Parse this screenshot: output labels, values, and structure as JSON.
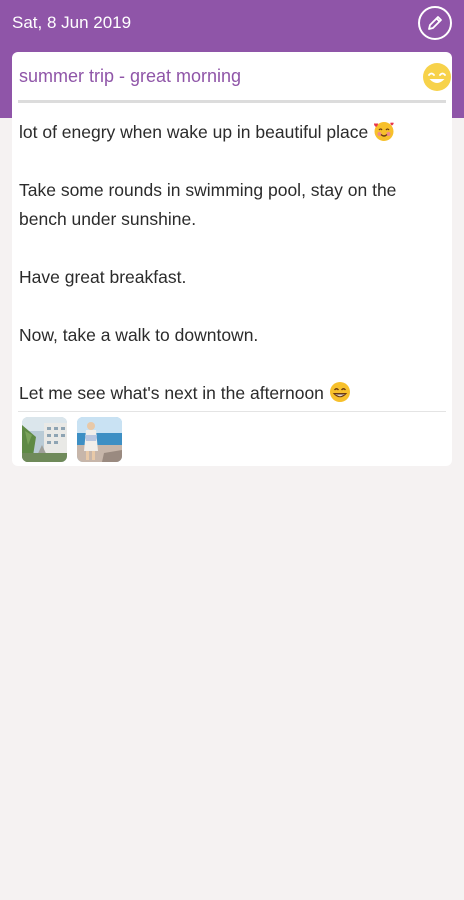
{
  "header": {
    "date": "Sat, 8 Jun 2019",
    "edit_icon": "pencil-icon"
  },
  "entry": {
    "title": "summer trip - great morning",
    "mood_icon": "smiley-mood-icon",
    "paragraphs": [
      {
        "text": "lot of enegry when wake up in beautiful place",
        "emoji": "smiling-face-with-hearts"
      },
      {
        "text": "Take some rounds in swimming pool, stay on the bench under sunshine."
      },
      {
        "text": "Have great breakfast."
      },
      {
        "text": "Now, take a walk to downtown."
      },
      {
        "text": "Let me see what's next in the afternoon",
        "emoji": "grinning-face"
      }
    ],
    "photos": [
      "resort-photo",
      "beach-photo"
    ]
  },
  "colors": {
    "header": "#8f55a8",
    "background": "#f5f2f2",
    "card": "#ffffff",
    "title": "#8f55a8",
    "mood": "#f7d24a"
  }
}
